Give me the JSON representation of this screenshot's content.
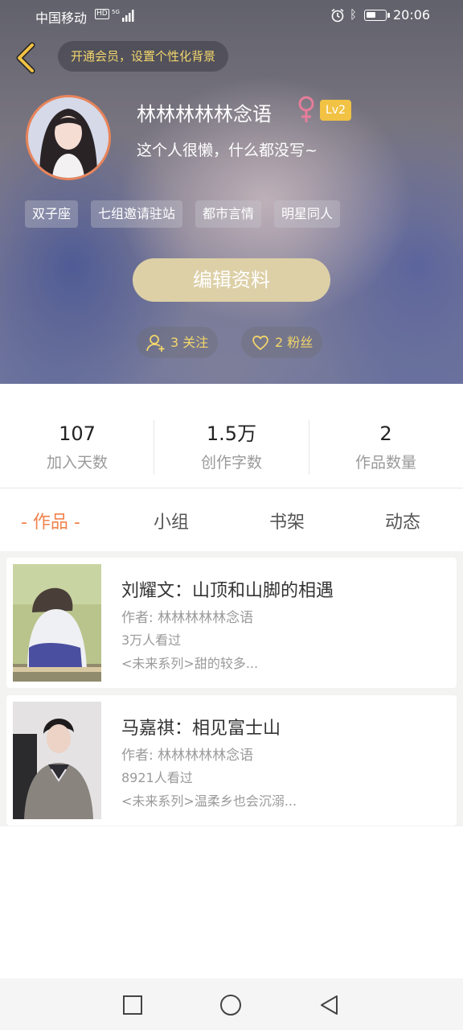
{
  "status_bar": {
    "carrier": "中国移动",
    "hd": "HD",
    "network": "5G",
    "time": "20:06"
  },
  "header": {
    "vip_prompt": "开通会员，设置个性化背景",
    "username": "林林林林林念语",
    "gender_symbol": "♀",
    "level": "Lv2",
    "bio": "这个人很懒，什么都没写~",
    "tags": [
      "双子座",
      "七组邀请驻站",
      "都市言情",
      "明星同人"
    ],
    "edit_button": "编辑资料",
    "following": "3 关注",
    "fans": "2 粉丝"
  },
  "stats": [
    {
      "value": "107",
      "label": "加入天数"
    },
    {
      "value": "1.5万",
      "label": "创作字数"
    },
    {
      "value": "2",
      "label": "作品数量"
    }
  ],
  "tabs": [
    {
      "label": "- 作品 -",
      "active": true
    },
    {
      "label": "小组",
      "active": false
    },
    {
      "label": "书架",
      "active": false
    },
    {
      "label": "动态",
      "active": false
    }
  ],
  "works": [
    {
      "title": "刘耀文：山顶和山脚的相遇",
      "author": "作者: 林林林林林念语",
      "views": "3万人看过",
      "desc": "<未来系列>甜的较多..."
    },
    {
      "title": "马嘉祺：相见富士山",
      "author": "作者: 林林林林林念语",
      "views": "8921人看过",
      "desc": "<未来系列>温柔乡也会沉溺..."
    }
  ],
  "colors": {
    "accent": "#f0834c",
    "gold": "#f3d66b",
    "edit_button": "#ddd0a7",
    "level_badge": "#f1c244",
    "avatar_border": "#e9845a"
  }
}
